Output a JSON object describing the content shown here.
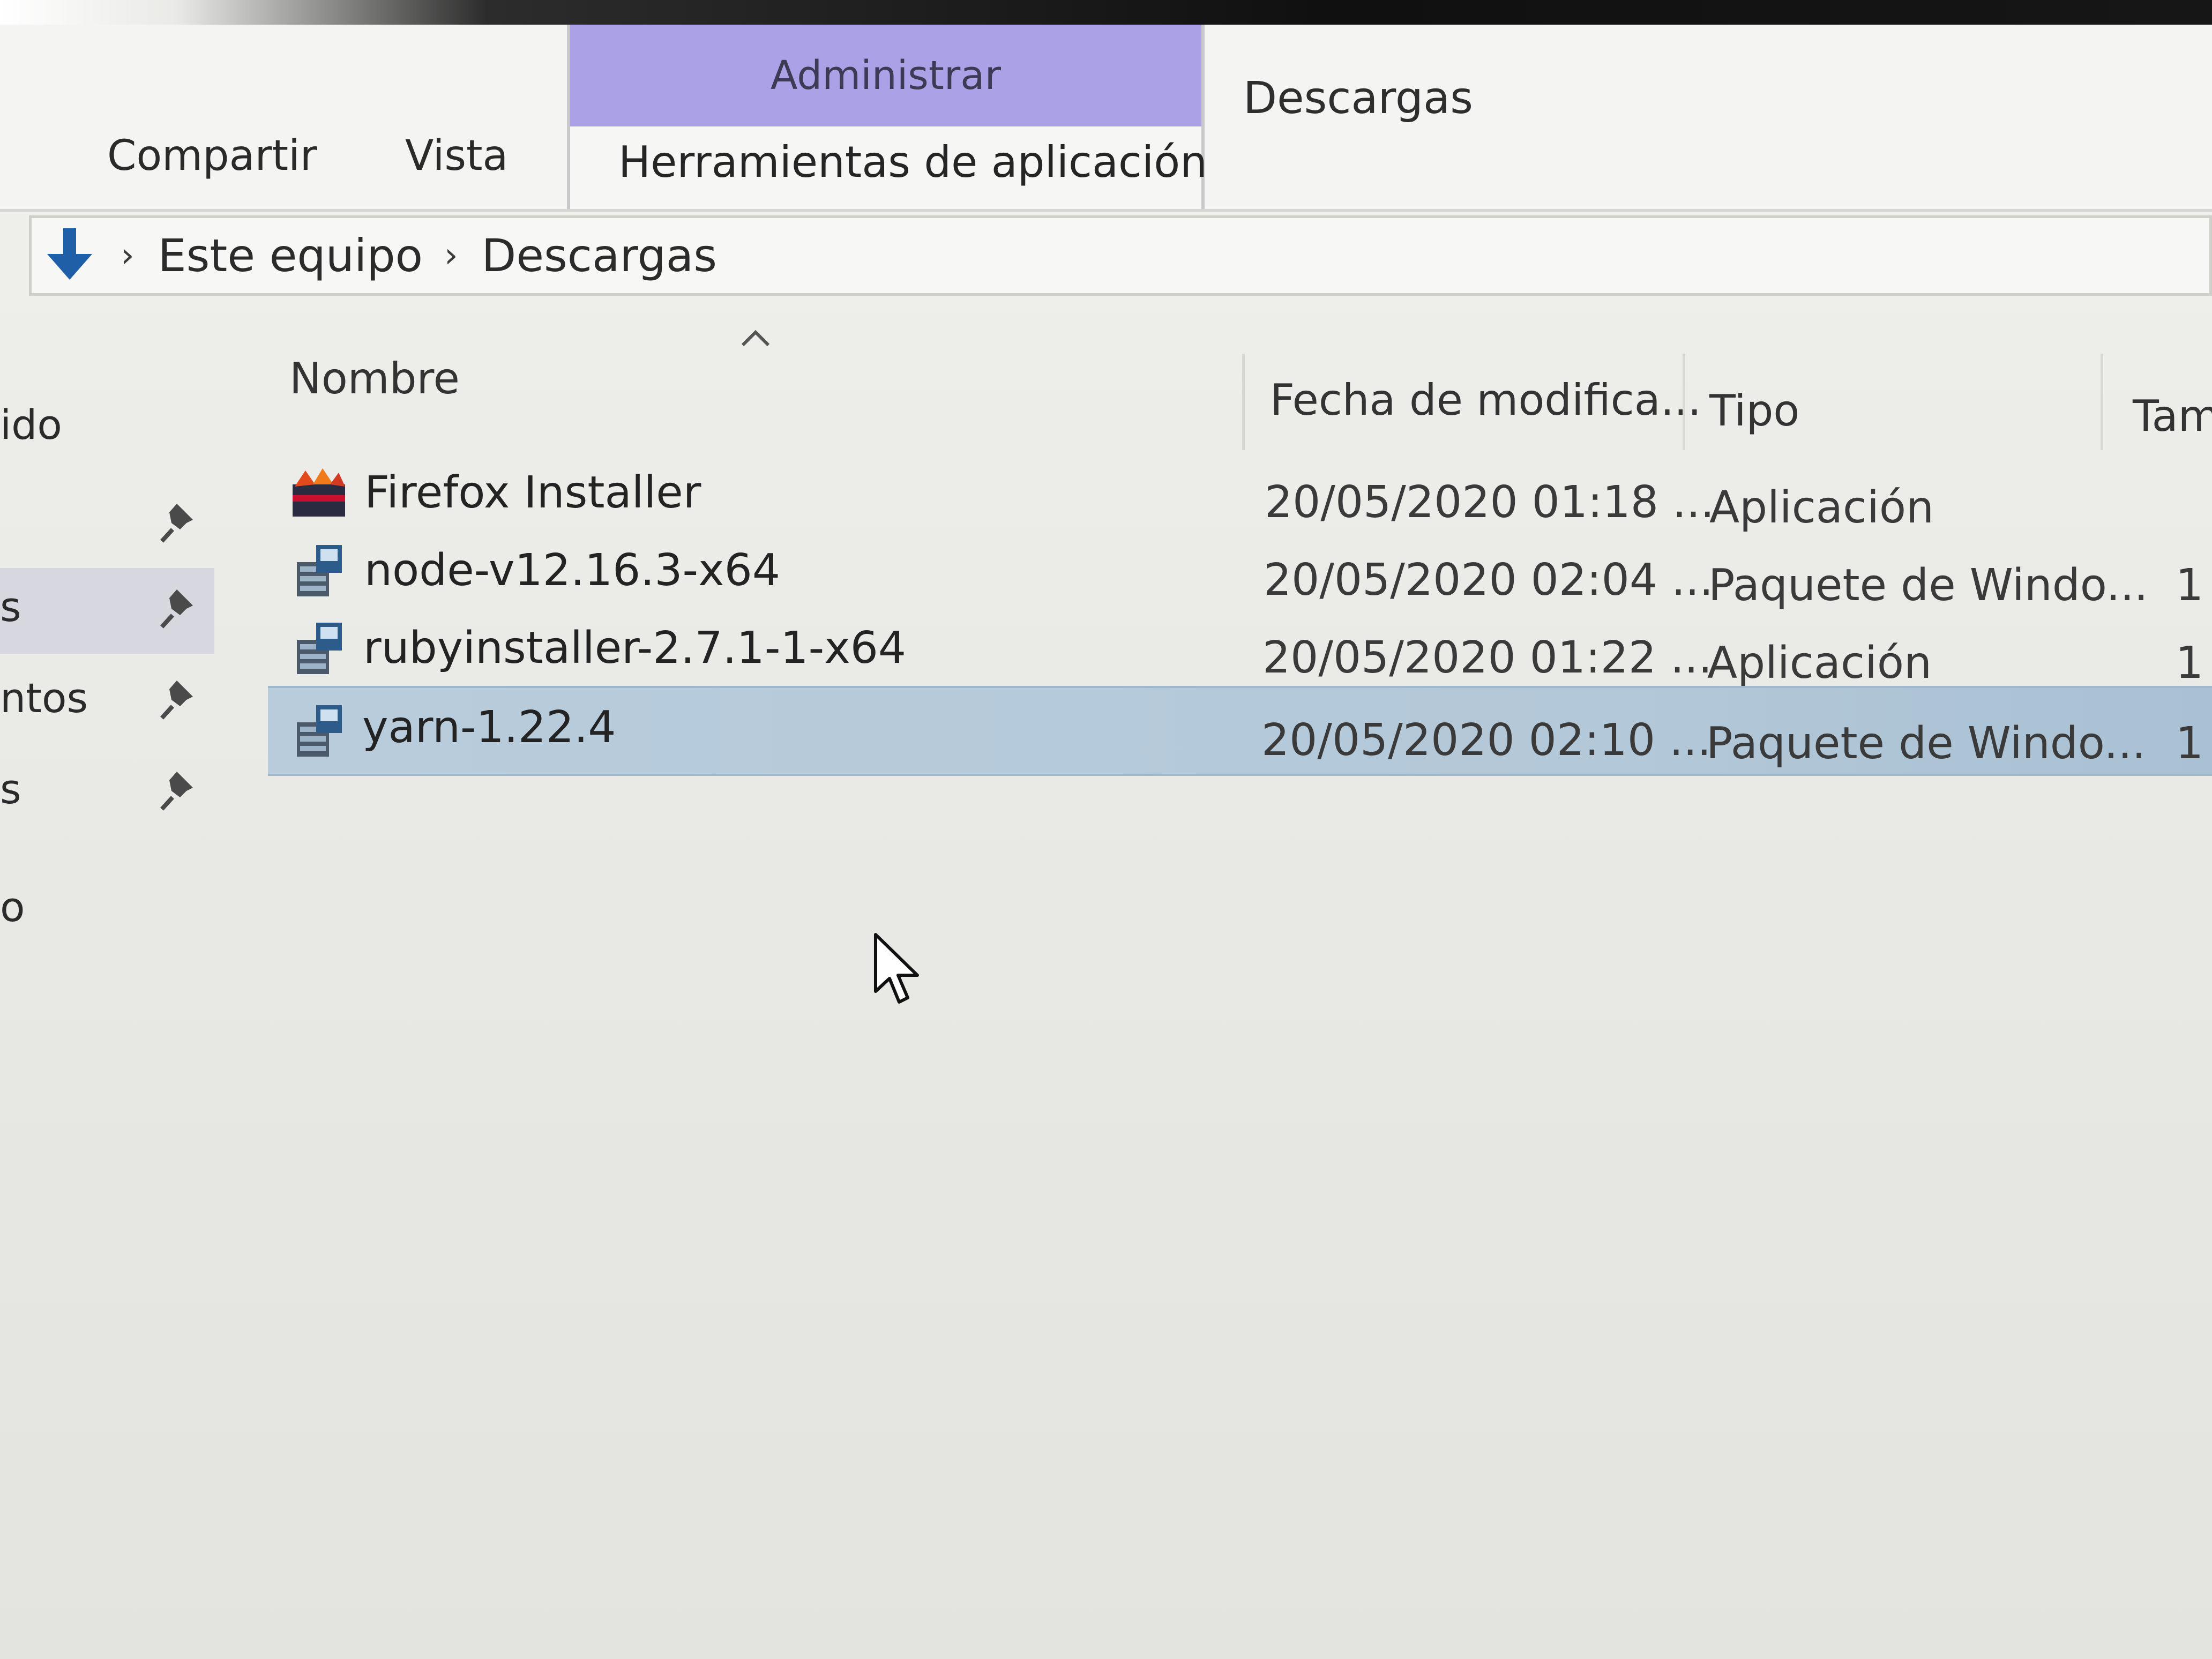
{
  "ribbon": {
    "tabs": [
      "Compartir",
      "Vista"
    ],
    "context_group_label": "Administrar",
    "context_tab": "Herramientas de aplicación",
    "window_title": "Descargas"
  },
  "address_bar": {
    "icon": "download-arrow-icon",
    "breadcrumbs": [
      "Este equipo",
      "Descargas"
    ]
  },
  "nav_pane": {
    "items": [
      {
        "label": "ido",
        "pinned": false
      },
      {
        "label": "",
        "pinned": true
      },
      {
        "label": "s",
        "pinned": true,
        "selected": true
      },
      {
        "label": "ntos",
        "pinned": true
      },
      {
        "label": "s",
        "pinned": true
      },
      {
        "label": "o",
        "pinned": false
      }
    ]
  },
  "file_list": {
    "columns": [
      "Nombre",
      "Fecha de modifica...",
      "Tipo",
      "Tam"
    ],
    "sort_indicator": "sort-ascending-icon",
    "rows": [
      {
        "name": "Firefox Installer",
        "date": "20/05/2020 01:18 ...",
        "type": "Aplicación",
        "size": "",
        "icon": "firefox-installer-icon",
        "selected": false
      },
      {
        "name": "node-v12.16.3-x64",
        "date": "20/05/2020 02:04 ...",
        "type": "Paquete de Windo...",
        "size": "1",
        "icon": "msi-package-icon",
        "selected": false
      },
      {
        "name": "rubyinstaller-2.7.1-1-x64",
        "date": "20/05/2020 01:22 ...",
        "type": "Aplicación",
        "size": "1",
        "icon": "msi-package-icon",
        "selected": false
      },
      {
        "name": "yarn-1.22.4",
        "date": "20/05/2020 02:10 ...",
        "type": "Paquete de Windo...",
        "size": "1",
        "icon": "msi-package-icon",
        "selected": true
      }
    ]
  },
  "colors": {
    "context_header": "#aaa1e6",
    "selection": "#b8ccdc",
    "address_icon": "#1f5fa8"
  }
}
